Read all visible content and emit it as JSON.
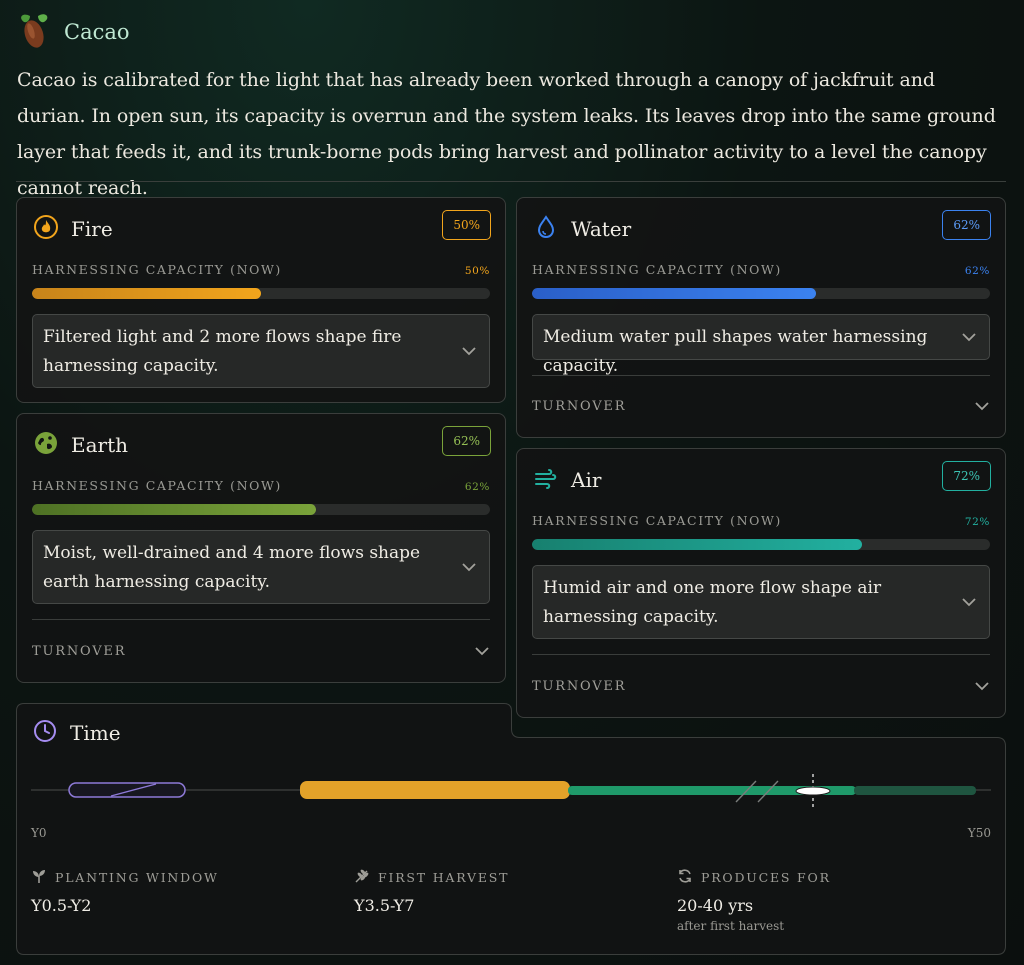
{
  "header": {
    "title": "Cacao",
    "icon": "cacao-pod-icon"
  },
  "intro": "Cacao is calibrated for the light that has already been worked through a canopy of jackfruit and durian. In open sun, its capacity is overrun and the system leaks. Its leaves drop into the same ground layer that feeds it, and its trunk-borne pods bring harvest and pollinator activity to a level the canopy cannot reach.",
  "elements": {
    "fire": {
      "name": "Fire",
      "badge": "50%",
      "capacity_label": "HARNESSING CAPACITY (NOW)",
      "capacity_pct": "50%",
      "capacity_value": 0.5,
      "color": "#f2a51c",
      "flows": "Filtered light and 2 more flows shape fire harnessing capacity."
    },
    "water": {
      "name": "Water",
      "badge": "62%",
      "capacity_label": "HARNESSING CAPACITY (NOW)",
      "capacity_pct": "62%",
      "capacity_value": 0.62,
      "color": "#3b82f0",
      "flows": "Medium water pull shapes water harnessing capacity.",
      "turnover": "TURNOVER"
    },
    "earth": {
      "name": "Earth",
      "badge": "62%",
      "capacity_label": "HARNESSING CAPACITY (NOW)",
      "capacity_pct": "62%",
      "capacity_value": 0.62,
      "color": "#7aa33a",
      "flows": "Moist, well-drained and 4 more flows shape earth harnessing capacity.",
      "turnover": "TURNOVER"
    },
    "air": {
      "name": "Air",
      "badge": "72%",
      "capacity_label": "HARNESSING CAPACITY (NOW)",
      "capacity_pct": "72%",
      "capacity_value": 0.72,
      "color": "#22b0a0",
      "flows": "Humid air and one more flow shape air harnessing capacity.",
      "turnover": "TURNOVER"
    }
  },
  "time": {
    "name": "Time",
    "axis_start": "Y0",
    "axis_end": "Y50",
    "stats": [
      {
        "icon": "sprout-icon",
        "label": "PLANTING WINDOW",
        "value": "Y0.5-Y2"
      },
      {
        "icon": "wheat-icon",
        "label": "FIRST HARVEST",
        "value": "Y3.5-Y7"
      },
      {
        "icon": "refresh-icon",
        "label": "PRODUCES FOR",
        "value": "20-40 yrs",
        "sub": "after first harvest"
      }
    ]
  },
  "colors": {
    "fire": "#f2a51c",
    "water": "#3b82f0",
    "earth": "#7aa33a",
    "air": "#22b0a0",
    "time": "#a58cf0",
    "harvest": "#e3a229",
    "produce": "#1f9a6a"
  }
}
